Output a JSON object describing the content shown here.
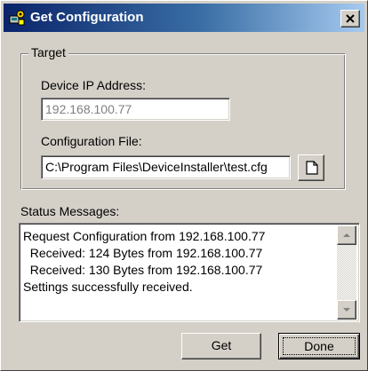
{
  "window": {
    "title": "Get Configuration",
    "icon": "device-installer-icon",
    "close_icon": "close-icon"
  },
  "target_group": {
    "label": "Target",
    "ip_label": "Device IP Address:",
    "ip_value": "192.168.100.77",
    "config_label": "Configuration File:",
    "config_value": "C:\\Program Files\\DeviceInstaller\\test.cfg",
    "browse_icon": "document-icon"
  },
  "status": {
    "label": "Status Messages:",
    "lines": [
      "Request Configuration from 192.168.100.77",
      "  Received: 124 Bytes from 192.168.100.77",
      "  Received: 130 Bytes from 192.168.100.77",
      "Settings successfully received."
    ]
  },
  "buttons": {
    "get_label": "Get",
    "done_label": "Done"
  },
  "colors": {
    "title_start": "#0a246a",
    "title_end": "#a6caf0",
    "face": "#d4d0c8",
    "disabled_text": "#808080"
  }
}
